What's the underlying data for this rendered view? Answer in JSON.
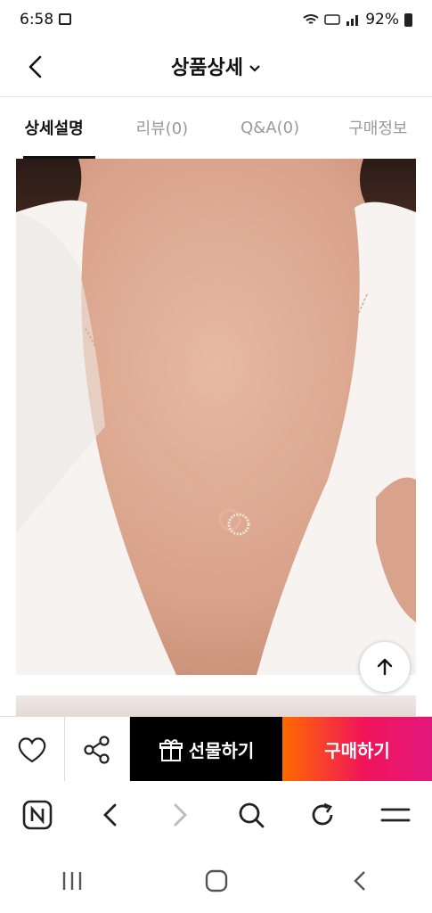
{
  "status_bar": {
    "time": "6:58",
    "battery": "92%"
  },
  "header": {
    "title": "상품상세"
  },
  "tabs": [
    {
      "label": "상세설명"
    },
    {
      "label": "리뷰(0)"
    },
    {
      "label": "Q&A(0)"
    },
    {
      "label": "구매정보"
    }
  ],
  "action_bar": {
    "gift_label": "선물하기",
    "buy_label": "구매하기"
  },
  "icons": [
    "back-icon",
    "chevron-down-icon",
    "arrow-up-icon",
    "heart-icon",
    "share-icon",
    "gift-icon",
    "naver-icon",
    "browser-back-icon",
    "browser-forward-icon",
    "search-icon",
    "refresh-icon",
    "menu-icon",
    "recent-apps-icon",
    "home-icon",
    "system-back-icon"
  ],
  "colors": {
    "buy_gradient_start": "#ff6a00",
    "buy_gradient_end": "#e3187c",
    "gift_bg": "#000000"
  }
}
